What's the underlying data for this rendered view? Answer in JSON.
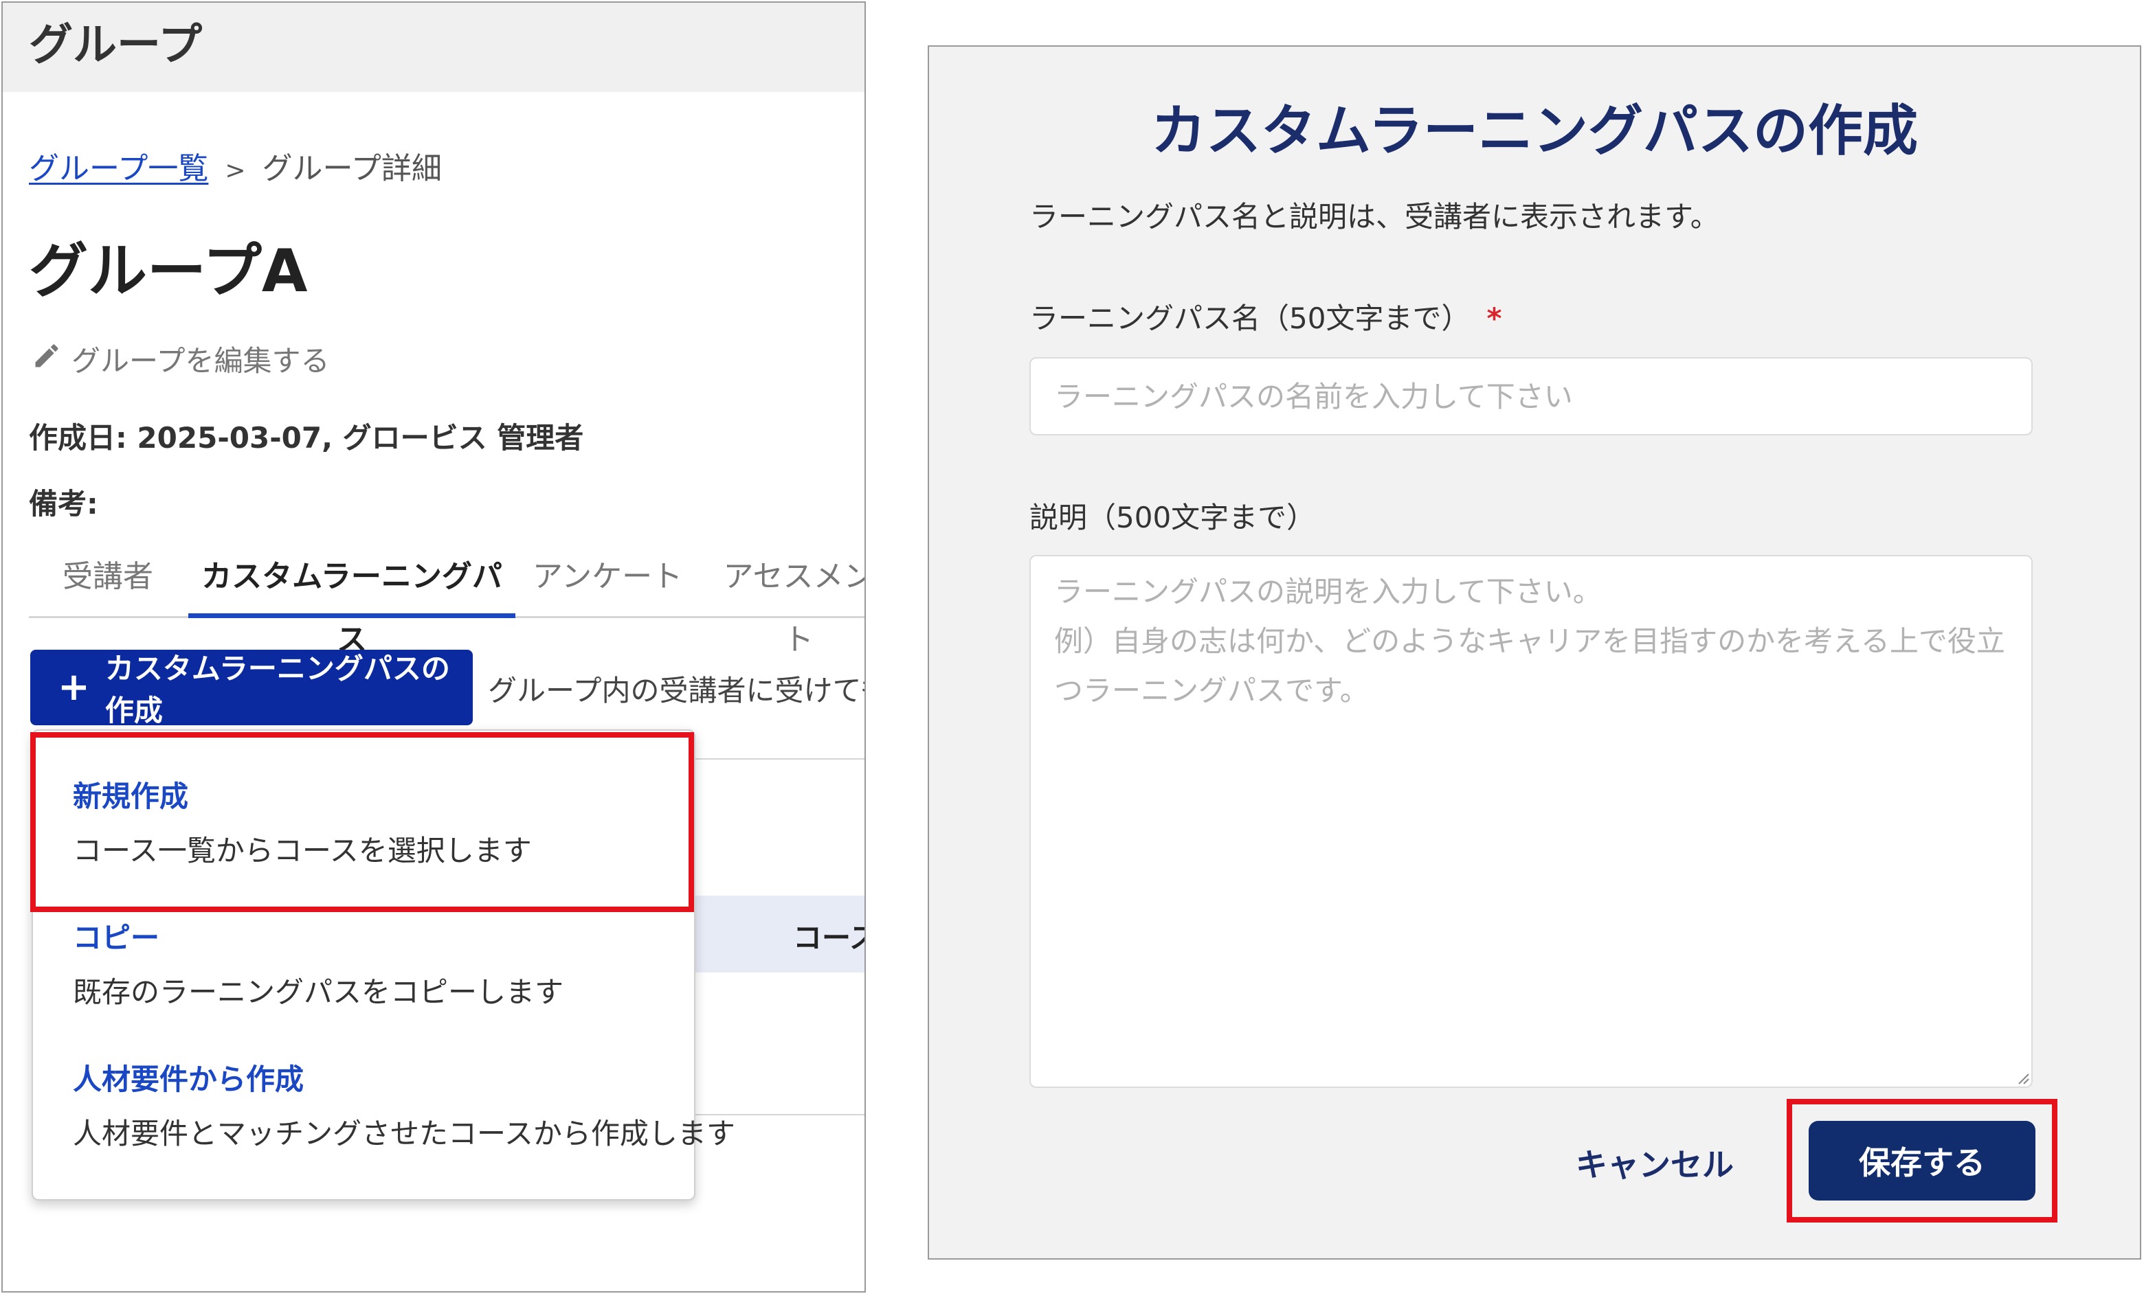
{
  "left": {
    "header_title": "グループ",
    "breadcrumb": {
      "link": "グループ一覧",
      "separator": ">",
      "current": "グループ詳細"
    },
    "group_title": "グループA",
    "edit_label": "グループを編集する",
    "created_line": "作成日: 2025-03-07, グロービス 管理者",
    "notes_label": "備考:",
    "tabs": [
      "受講者",
      "カスタムラーニングパス",
      "アンケート",
      "アセスメント"
    ],
    "active_tab": 1,
    "create_button_label": "カスタムラーニングパスの作成",
    "create_hint": "グループ内の受講者に受けても",
    "table_col_fragment": "コース",
    "dropdown": [
      {
        "title": "新規作成",
        "desc": "コース一覧からコースを選択します"
      },
      {
        "title": "コピー",
        "desc": "既存のラーニングパスをコピーします"
      },
      {
        "title": "人材要件から作成",
        "desc": "人材要件とマッチングさせたコースから作成します"
      }
    ]
  },
  "modal": {
    "title": "カスタムラーニングパスの作成",
    "subtitle": "ラーニングパス名と説明は、受講者に表示されます。",
    "name_label": "ラーニングパス名（50文字まで）",
    "required_mark": "*",
    "name_placeholder": "ラーニングパスの名前を入力して下さい",
    "name_value": "",
    "desc_label": "説明（500文字まで）",
    "desc_placeholder": "ラーニングパスの説明を入力して下さい。\n例）自身の志は何か、どのようなキャリアを目指すのかを考える上で役立つラーニングパスです。",
    "desc_value": "",
    "cancel_label": "キャンセル",
    "save_label": "保存する"
  },
  "colors": {
    "primary": "#0b2aa0",
    "link": "#1a47c4",
    "title_navy": "#1b2d6b",
    "save_button": "#112d6e",
    "highlight_red": "#e5121c",
    "required_red": "#d9232d"
  },
  "icons": [
    "pencil-icon",
    "plus-icon",
    "resize-handle-icon"
  ]
}
